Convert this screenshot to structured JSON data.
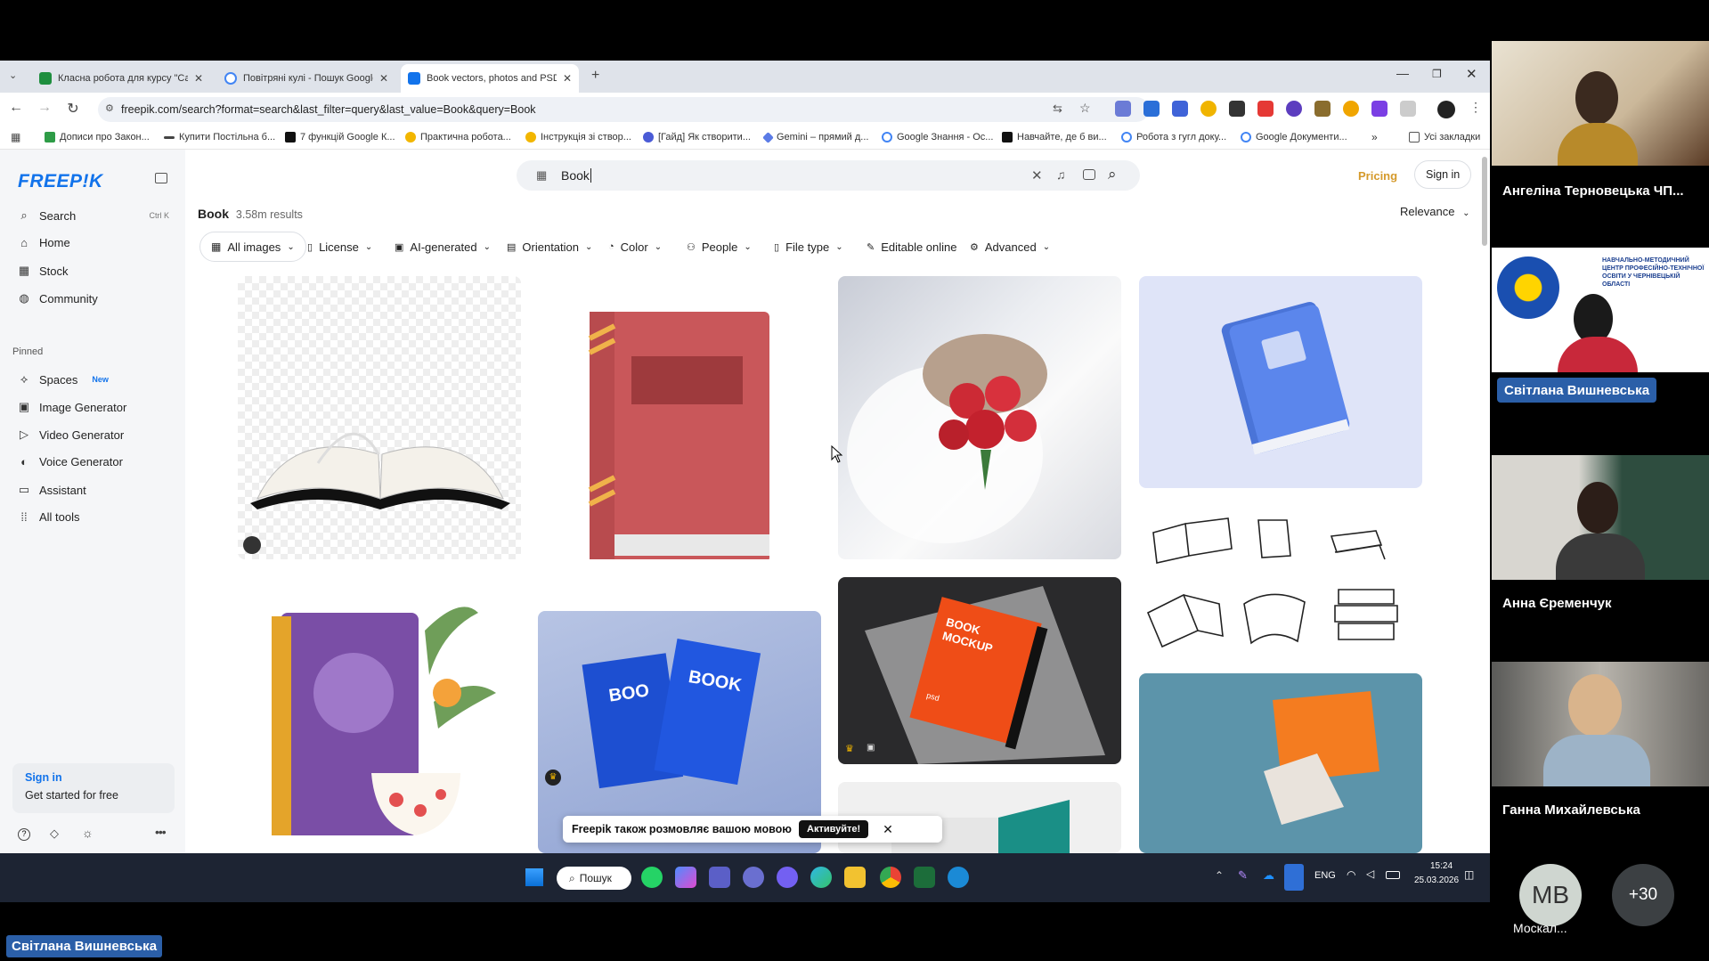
{
  "browser": {
    "tabs": [
      {
        "title": "Класна робота для курсу \"Са",
        "favicon_color": "#1e8e3e"
      },
      {
        "title": "Повітряні кулі - Пошук Google",
        "favicon_color": "#4285f4"
      },
      {
        "title": "Book vectors, photos and PSD",
        "favicon_color": "#1273eb"
      }
    ],
    "url": "freepik.com/search?format=search&last_filter=query&last_value=Book&query=Book",
    "bookmarks": [
      "Дописи про Закон...",
      "Купити Постільна б...",
      "7 функцій Google К...",
      "Практична робота...",
      "Інструкція зі створ...",
      "[Гайд] Як створити...",
      "Gemini – прямий д...",
      "Google Знання - Ос...",
      "Навчайте, де б ви...",
      "Робота з гугл доку...",
      "Google Документи..."
    ],
    "all_bookmarks": "Усі закладки",
    "more_bookmarks": "»"
  },
  "sidebar": {
    "logo": "FREEP!K",
    "search": {
      "label": "Search",
      "shortcut": "Ctrl K"
    },
    "nav": [
      "Home",
      "Stock",
      "Community"
    ],
    "pinned_label": "Pinned",
    "pinned": [
      {
        "label": "Spaces",
        "badge": "New"
      },
      {
        "label": "Image Generator"
      },
      {
        "label": "Video Generator"
      },
      {
        "label": "Voice Generator"
      },
      {
        "label": "Assistant"
      },
      {
        "label": "All tools"
      }
    ],
    "signin": {
      "title": "Sign in",
      "subtitle": "Get started for free"
    }
  },
  "header": {
    "search_value": "Book",
    "pricing": "Pricing",
    "signin": "Sign in"
  },
  "results": {
    "query": "Book",
    "count": "3.58m results",
    "sort": "Relevance",
    "filters": [
      "All images",
      "License",
      "AI-generated",
      "Orientation",
      "Color",
      "People",
      "File type",
      "Editable online",
      "Advanced"
    ]
  },
  "mockup_text": {
    "book": "BOOK",
    "mockup": "MOCKUP",
    "psd": "psd",
    "boo": "BOO"
  },
  "toast": {
    "text": "Freepik також розмовляє вашою мовою",
    "button": "Активуйте!",
    "close": "✕"
  },
  "taskbar": {
    "search": "Пошук",
    "lang": "ENG",
    "time": "15:24",
    "date": "25.03.2026"
  },
  "video_call": {
    "participants": [
      "Ангеліна Терновецька ЧП...",
      "Світлана Вишневська",
      "Анна Єременчук",
      "Ганна Михайлевська"
    ],
    "banner": "НАВЧАЛЬНО-МЕТОДИЧНИЙ ЦЕНТР ПРОФЕСІЙНО-ТЕХНІЧНОЇ ОСВІТИ У ЧЕРНІВЕЦЬКІЙ ОБЛАСТІ",
    "extra_initials": "МВ",
    "extra_name": "Москал...",
    "more_count": "+30"
  },
  "speaker_label": "Світлана Вишневська",
  "accent": "#1273eb"
}
